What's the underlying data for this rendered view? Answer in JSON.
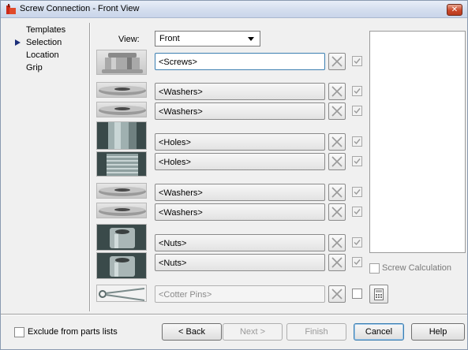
{
  "window": {
    "title": "Screw Connection - Front View",
    "close_label": "✕"
  },
  "nav": {
    "items": [
      {
        "label": "Templates",
        "selected": false
      },
      {
        "label": "Selection",
        "selected": true
      },
      {
        "label": "Location",
        "selected": false
      },
      {
        "label": "Grip",
        "selected": false
      }
    ]
  },
  "view": {
    "label": "View:",
    "value": "Front"
  },
  "parts": [
    {
      "name": "screw",
      "value": "<Screws>",
      "checked": true
    },
    {
      "name": "washer",
      "value": "<Washers>",
      "checked": true
    },
    {
      "name": "washer",
      "value": "<Washers>",
      "checked": true
    },
    {
      "name": "hole",
      "value": "<Holes>",
      "checked": true
    },
    {
      "name": "hole",
      "value": "<Holes>",
      "checked": true
    },
    {
      "name": "washer",
      "value": "<Washers>",
      "checked": true
    },
    {
      "name": "washer",
      "value": "<Washers>",
      "checked": true
    },
    {
      "name": "nut",
      "value": "<Nuts>",
      "checked": true
    },
    {
      "name": "nut",
      "value": "<Nuts>",
      "checked": true
    },
    {
      "name": "cotter-pin",
      "value": "<Cotter Pins>",
      "checked": false
    }
  ],
  "screw_calc": {
    "label": "Screw Calculation"
  },
  "footer": {
    "exclude_label": "Exclude from parts lists",
    "back_label": "< Back",
    "next_label": "Next >",
    "finish_label": "Finish",
    "cancel_label": "Cancel",
    "help_label": "Help"
  },
  "colors": {
    "accent": "#3c7fb1",
    "nav_arrow": "#1c2f7a",
    "close": "#c9482a"
  }
}
